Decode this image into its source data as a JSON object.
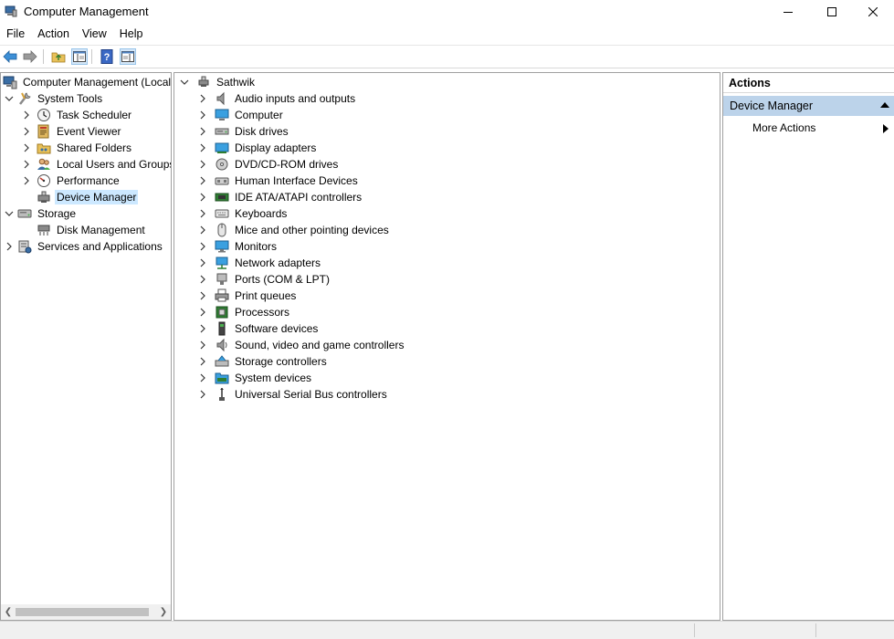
{
  "window": {
    "title": "Computer Management",
    "icon": "computer-management-icon",
    "controls": [
      "minimize-icon",
      "maximize-icon",
      "close-icon"
    ]
  },
  "menu": {
    "items": [
      "File",
      "Action",
      "View",
      "Help"
    ]
  },
  "toolbar": {
    "buttons": [
      "back-arrow-icon",
      "forward-arrow-icon",
      "up-folder-icon",
      "show-hide-tree-icon",
      "help-icon",
      "show-hide-action-pane-icon"
    ]
  },
  "left_tree": {
    "root": "Computer Management (Local",
    "system_tools": {
      "label": "System Tools",
      "children": [
        "Task Scheduler",
        "Event Viewer",
        "Shared Folders",
        "Local Users and Groups",
        "Performance",
        "Device Manager"
      ]
    },
    "storage": {
      "label": "Storage",
      "children": [
        "Disk Management"
      ]
    },
    "services": "Services and Applications",
    "selected": "Device Manager"
  },
  "device_tree": {
    "root": "Sathwik",
    "categories": [
      "Audio inputs and outputs",
      "Computer",
      "Disk drives",
      "Display adapters",
      "DVD/CD-ROM drives",
      "Human Interface Devices",
      "IDE ATA/ATAPI controllers",
      "Keyboards",
      "Mice and other pointing devices",
      "Monitors",
      "Network adapters",
      "Ports (COM & LPT)",
      "Print queues",
      "Processors",
      "Software devices",
      "Sound, video and game controllers",
      "Storage controllers",
      "System devices",
      "Universal Serial Bus controllers"
    ]
  },
  "actions": {
    "header": "Actions",
    "section": "Device Manager",
    "more": "More Actions"
  },
  "colors": {
    "selection": "#cce8ff",
    "actions_section": "#bcd3ea",
    "pane_border": "#a0a0a0"
  }
}
